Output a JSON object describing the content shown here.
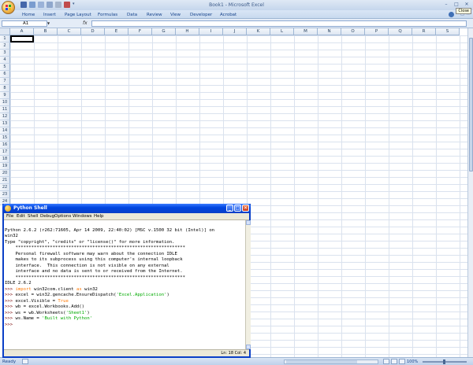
{
  "excel": {
    "window_title": "Book1 - Microsoft Excel",
    "close_tooltip": "Close",
    "tabs": [
      "Home",
      "Insert",
      "Page Layout",
      "Formulas",
      "Data",
      "Review",
      "View",
      "Developer",
      "Acrobat"
    ],
    "name_box": "A1",
    "fx_label": "fx",
    "columns": [
      "A",
      "B",
      "C",
      "D",
      "E",
      "F",
      "G",
      "H",
      "I",
      "J",
      "K",
      "L",
      "M",
      "N",
      "O",
      "P",
      "Q",
      "R",
      "S"
    ],
    "rows": [
      "1",
      "2",
      "3",
      "4",
      "5",
      "6",
      "7",
      "8",
      "9",
      "10",
      "11",
      "12",
      "13",
      "14",
      "15",
      "16",
      "17",
      "18",
      "19",
      "20",
      "21",
      "22",
      "23",
      "24"
    ],
    "status": "Ready",
    "zoom": "100%"
  },
  "python_shell": {
    "title": "Python Shell",
    "menu": [
      "File",
      "Edit",
      "Shell",
      "Debug",
      "Options",
      "Windows",
      "Help"
    ],
    "banner": [
      "Python 2.6.2 (r262:71605, Apr 14 2009, 22:40:02) [MSC v.1500 32 bit (Intel)] on",
      "win32",
      "Type \"copyright\", \"credits\" or \"license()\" for more information.",
      "",
      "    ****************************************************************",
      "    Personal firewall software may warn about the connection IDLE",
      "    makes to its subprocess using this computer's internal loopback",
      "    interface.  This connection is not visible on any external",
      "    interface and no data is sent to or received from the Internet.",
      "    ****************************************************************",
      "",
      "IDLE 2.6.2"
    ],
    "prompt": ">>>",
    "code": {
      "line1": {
        "kw1": "import",
        "mid": " win32com.client ",
        "kw2": "as",
        "rest": " win32"
      },
      "line2": {
        "pre": " excel = win32.gencache.EnsureDispatch(",
        "str": "'Excel.Application'",
        "post": ")"
      },
      "line3": {
        "pre": " excel.Visible = ",
        "val": "True"
      },
      "line4": {
        "pre": " wb = excel.Workbooks.Add()"
      },
      "line5": {
        "pre": " ws = wb.Worksheets(",
        "str": "'Sheet1'",
        "post": ")"
      },
      "line6": {
        "pre": " ws.Name = ",
        "str": "'Built with Python'"
      }
    },
    "status": "Ln: 18 Col: 4"
  },
  "colors": {
    "keyword": "#ff7700",
    "string": "#00aa00",
    "prompt": "#770000",
    "xp_title": "#0a3fc7"
  }
}
